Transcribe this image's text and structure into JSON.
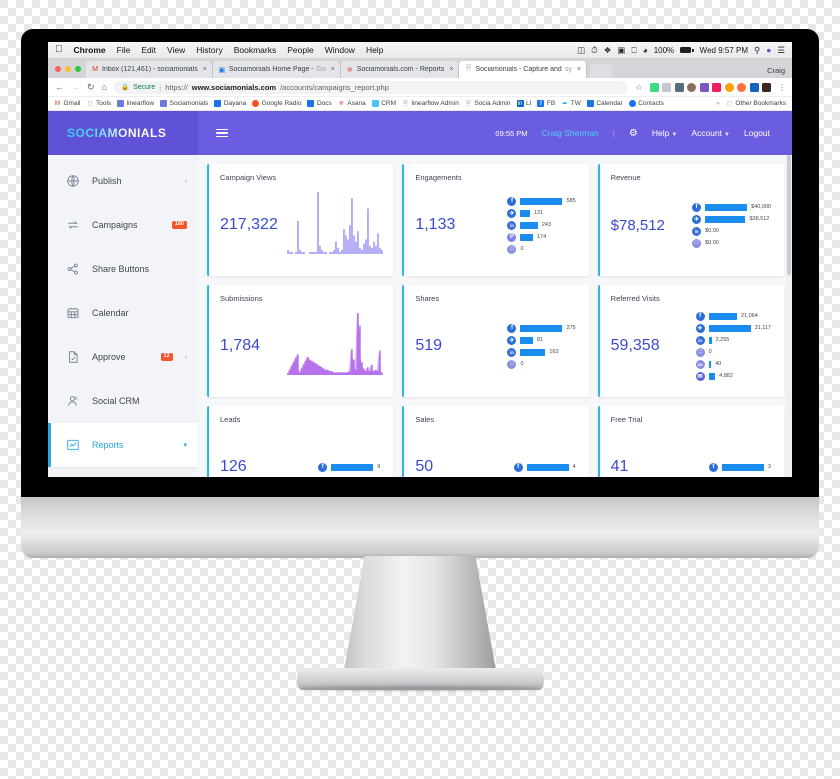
{
  "os_menubar": {
    "apple_icon": "apple-icon",
    "items": [
      "Chrome",
      "File",
      "Edit",
      "View",
      "History",
      "Bookmarks",
      "People",
      "Window",
      "Help"
    ],
    "status": {
      "icons": [
        "display-icon",
        "clock-icon",
        "dropbox-icon",
        "screen-icon",
        "keyboard-icon",
        "wifi-icon"
      ],
      "battery_percent": "100%",
      "battery_icon": "battery-icon",
      "datetime": "Wed 9:57 PM",
      "search_icon": "search-icon",
      "siri_icon": "siri-icon",
      "notification_icon": "notification-center-icon"
    }
  },
  "browser": {
    "window_controls": [
      "close",
      "minimize",
      "maximize"
    ],
    "tabs": [
      {
        "favicon": "gmail-icon",
        "title": "Inbox (121,461) - sociamonials",
        "title_dim": "",
        "active": false
      },
      {
        "favicon": "chrome-doc-icon",
        "title": "Sociamonials Home Page - ",
        "title_dim": "Go",
        "active": false
      },
      {
        "favicon": "asana-icon",
        "title": "Sociamonials.com - Reports",
        "title_dim": "",
        "active": false
      },
      {
        "favicon": "page-icon",
        "title": "Sociamonials - Capture and ",
        "title_dim": "sy",
        "active": true
      }
    ],
    "profile_name": "Craig",
    "nav": {
      "back": "←",
      "forward": "→",
      "reload": "↻",
      "home": "⌂"
    },
    "omnibox": {
      "lock_icon": "lock-icon",
      "secure_label": "Secure",
      "url_scheme": "https://",
      "url_host": "www.sociamonials.com",
      "url_path": "/accounts/campaigns_report.php",
      "star_icon": "bookmark-star-icon",
      "menu_icon": "kebab-menu-icon"
    },
    "bookmarks": [
      {
        "icon": "gmail-icon",
        "label": "Gmail",
        "color": "#d93025"
      },
      {
        "icon": "folder-icon",
        "label": "Tools",
        "color": "#9aa0a6"
      },
      {
        "icon": "app-icon",
        "label": "linearflow",
        "color": "#6c7ae0"
      },
      {
        "icon": "app-icon",
        "label": "Sociamonials",
        "color": "#6c7ae0"
      },
      {
        "icon": "app-icon",
        "label": "Dayana",
        "color": "#1a73e8"
      },
      {
        "icon": "radio-icon",
        "label": "Google Radio",
        "color": "#f4511e"
      },
      {
        "icon": "docs-icon",
        "label": "Docs",
        "color": "#1a73e8"
      },
      {
        "icon": "asana-icon",
        "label": "Asana",
        "color": "#f06a6a"
      },
      {
        "icon": "crm-icon",
        "label": "CRM",
        "color": "#4fc3f7"
      },
      {
        "icon": "page-icon",
        "label": "linearflow Admin",
        "color": "#9aa0a6"
      },
      {
        "icon": "page-icon",
        "label": "Socia Admin",
        "color": "#9aa0a6"
      },
      {
        "icon": "linkedin-icon",
        "label": "LI",
        "color": "#0a66c2"
      },
      {
        "icon": "facebook-icon",
        "label": "FB",
        "color": "#1877f2"
      },
      {
        "icon": "twitter-icon",
        "label": "TW",
        "color": "#1da1f2"
      },
      {
        "icon": "calendar-icon",
        "label": "Calendar",
        "color": "#1a73e8"
      },
      {
        "icon": "contacts-icon",
        "label": "Contacts",
        "color": "#1a73e8"
      }
    ],
    "overflow_icon": "chevron-right-icon",
    "other_bookmarks": {
      "icon": "folder-icon",
      "label": "Other Bookmarks"
    }
  },
  "app": {
    "brand": "SOCIAMONIALS",
    "menu_toggle_icon": "hamburger-menu-icon",
    "header": {
      "time": "09:55 PM",
      "user": "Craig Sherman",
      "divider": "|",
      "settings_icon": "gear-icon",
      "help_label": "Help",
      "account_label": "Account",
      "logout_label": "Logout"
    },
    "sidebar": {
      "items": [
        {
          "label": "Publish",
          "icon": "globe-icon",
          "badge": null,
          "chevron": true,
          "active": false
        },
        {
          "label": "Campaigns",
          "icon": "repeat-icon",
          "badge": "160",
          "chevron": false,
          "active": false
        },
        {
          "label": "Share Buttons",
          "icon": "share-icon",
          "badge": null,
          "chevron": false,
          "active": false
        },
        {
          "label": "Calendar",
          "icon": "calendar-icon",
          "badge": null,
          "chevron": false,
          "active": false
        },
        {
          "label": "Approve",
          "icon": "document-icon",
          "badge": "12",
          "chevron": true,
          "active": false
        },
        {
          "label": "Social CRM",
          "icon": "user-icon",
          "badge": null,
          "chevron": false,
          "active": false
        },
        {
          "label": "Reports",
          "icon": "chart-icon",
          "badge": null,
          "chevron": true,
          "active": true
        }
      ]
    },
    "colors": {
      "header_purple": "#6a5de0",
      "brand_purple": "#5f52d6",
      "accent_cyan": "#2bb8e8",
      "metric_blue": "#3a4ad0",
      "bar_blue": "#1a8cf0",
      "badge_orange": "#f3552c",
      "spark_purple": "#8b7ef0",
      "spark_violet": "#a855e8"
    }
  },
  "chart_data": [
    {
      "type": "bar",
      "title": "Campaign Views",
      "total": "217,322",
      "chart_kind": "sparkline-spikes",
      "values": [
        2,
        1,
        1,
        0,
        1,
        16,
        2,
        1,
        1,
        0,
        0,
        1,
        1,
        1,
        1,
        30,
        4,
        2,
        1,
        1,
        0,
        1,
        1,
        2,
        6,
        3,
        1,
        2,
        12,
        9,
        7,
        14,
        27,
        9,
        6,
        11,
        3,
        2,
        5,
        7,
        22,
        4,
        3,
        6,
        4,
        10,
        3,
        2
      ],
      "color": "#8b7ef0",
      "ylim": [
        0,
        30
      ]
    },
    {
      "type": "bar",
      "title": "Engagements",
      "total": "1,133",
      "orientation": "horizontal",
      "categories": [
        "facebook",
        "twitter",
        "linkedin",
        "pinterest",
        "instagram"
      ],
      "values": [
        585,
        131,
        243,
        174,
        0
      ],
      "value_labels": [
        "585",
        "131",
        "243",
        "174",
        "0"
      ],
      "color": "#1a8cf0",
      "xlim": [
        0,
        585
      ]
    },
    {
      "type": "bar",
      "title": "Revenue",
      "total": "$78,512",
      "orientation": "horizontal",
      "categories": [
        "facebook",
        "twitter",
        "linkedin",
        "instagram"
      ],
      "values": [
        40000,
        38512,
        0,
        0
      ],
      "value_labels": [
        "$40,000",
        "$38,512",
        "$0.00",
        "$0.00"
      ],
      "color": "#1a8cf0",
      "xlim": [
        0,
        40000
      ]
    },
    {
      "type": "area",
      "title": "Submissions",
      "total": "1,784",
      "chart_kind": "sparkline-area-spikes",
      "values": [
        1,
        4,
        7,
        10,
        13,
        16,
        2,
        5,
        8,
        11,
        14,
        12,
        11,
        10,
        9,
        8,
        7,
        6,
        5,
        4,
        4,
        3,
        3,
        2,
        2,
        2,
        2,
        2,
        2,
        2,
        2,
        3,
        20,
        12,
        4,
        48,
        38,
        10,
        5,
        3,
        6,
        3,
        8,
        3,
        4,
        3,
        19,
        2
      ],
      "color": "#a855e8",
      "ylim": [
        0,
        48
      ]
    },
    {
      "type": "bar",
      "title": "Shares",
      "total": "519",
      "orientation": "horizontal",
      "categories": [
        "facebook",
        "twitter",
        "linkedin",
        "instagram"
      ],
      "values": [
        275,
        81,
        163,
        0
      ],
      "value_labels": [
        "275",
        "81",
        "163",
        "0"
      ],
      "color": "#1a8cf0",
      "xlim": [
        0,
        275
      ]
    },
    {
      "type": "bar",
      "title": "Referred Visits",
      "total": "59,358",
      "orientation": "horizontal",
      "categories": [
        "facebook",
        "twitter",
        "linkedin",
        "instagram",
        "stumbleupon",
        "email"
      ],
      "values": [
        21064,
        31117,
        2255,
        0,
        40,
        4882
      ],
      "value_labels": [
        "21,064",
        "31,117",
        "2,255",
        "0",
        "40",
        "4,882"
      ],
      "color": "#1a8cf0",
      "xlim": [
        0,
        31117
      ]
    },
    {
      "type": "bar",
      "title": "Leads",
      "total": "126",
      "orientation": "horizontal",
      "categories": [
        "facebook"
      ],
      "values": [
        9
      ],
      "value_labels": [
        "9"
      ],
      "color": "#1a8cf0",
      "xlim": [
        0,
        9
      ]
    },
    {
      "type": "bar",
      "title": "Sales",
      "total": "50",
      "orientation": "horizontal",
      "categories": [
        "facebook"
      ],
      "values": [
        4
      ],
      "value_labels": [
        "4"
      ],
      "color": "#1a8cf0",
      "xlim": [
        0,
        4
      ]
    },
    {
      "type": "bar",
      "title": "Free Trial",
      "total": "41",
      "orientation": "horizontal",
      "categories": [
        "facebook"
      ],
      "values": [
        3
      ],
      "value_labels": [
        "3"
      ],
      "color": "#1a8cf0",
      "xlim": [
        0,
        3
      ]
    }
  ]
}
